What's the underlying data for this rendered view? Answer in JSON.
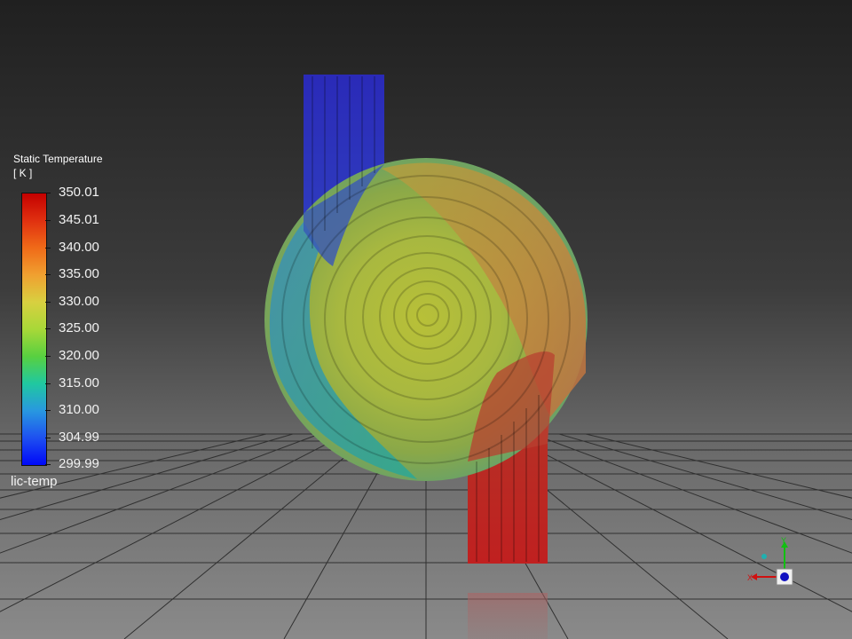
{
  "legend": {
    "title_line1": "Static Temperature",
    "title_line2": "[ K ]",
    "ticks": [
      "350.01",
      "345.01",
      "340.00",
      "335.00",
      "330.00",
      "325.00",
      "320.00",
      "315.00",
      "310.00",
      "304.99",
      "299.99"
    ],
    "colormap": [
      "#c40000",
      "#e03010",
      "#f06a18",
      "#f0a030",
      "#d8d040",
      "#a8d838",
      "#58d040",
      "#20c8a0",
      "#2898e0",
      "#1e50f0",
      "#0008f8"
    ]
  },
  "contour_name": "lic-temp",
  "axes": {
    "x_label": "X",
    "y_label": "Y",
    "x_color": "#d01010",
    "y_color": "#10c010",
    "z_color": "#1010c0"
  }
}
